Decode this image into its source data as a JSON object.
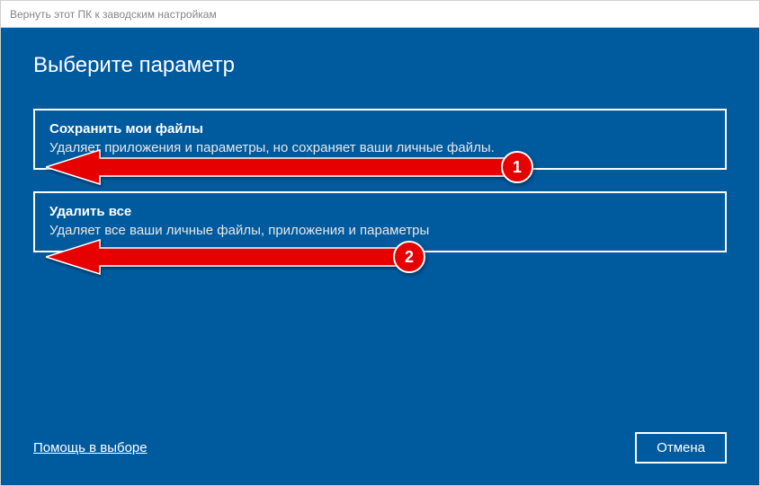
{
  "window": {
    "title": "Вернуть этот ПК к заводским настройкам"
  },
  "heading": "Выберите параметр",
  "options": [
    {
      "title": "Сохранить мои файлы",
      "desc": "Удаляет приложения и параметры, но сохраняет ваши личные файлы."
    },
    {
      "title": "Удалить все",
      "desc": "Удаляет все ваши личные файлы, приложения и параметры"
    }
  ],
  "footer": {
    "help": "Помощь в выборе",
    "cancel": "Отмена"
  },
  "annotations": {
    "badge1": "1",
    "badge2": "2",
    "color": "#e60000"
  }
}
